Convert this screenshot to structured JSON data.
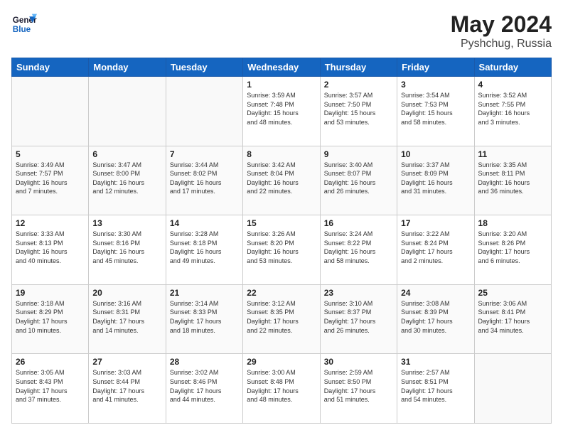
{
  "logo": {
    "line1": "General",
    "line2": "Blue"
  },
  "title": {
    "month_year": "May 2024",
    "location": "Pyshchug, Russia"
  },
  "days_of_week": [
    "Sunday",
    "Monday",
    "Tuesday",
    "Wednesday",
    "Thursday",
    "Friday",
    "Saturday"
  ],
  "weeks": [
    [
      {
        "day": "",
        "info": ""
      },
      {
        "day": "",
        "info": ""
      },
      {
        "day": "",
        "info": ""
      },
      {
        "day": "1",
        "info": "Sunrise: 3:59 AM\nSunset: 7:48 PM\nDaylight: 15 hours\nand 48 minutes."
      },
      {
        "day": "2",
        "info": "Sunrise: 3:57 AM\nSunset: 7:50 PM\nDaylight: 15 hours\nand 53 minutes."
      },
      {
        "day": "3",
        "info": "Sunrise: 3:54 AM\nSunset: 7:53 PM\nDaylight: 15 hours\nand 58 minutes."
      },
      {
        "day": "4",
        "info": "Sunrise: 3:52 AM\nSunset: 7:55 PM\nDaylight: 16 hours\nand 3 minutes."
      }
    ],
    [
      {
        "day": "5",
        "info": "Sunrise: 3:49 AM\nSunset: 7:57 PM\nDaylight: 16 hours\nand 7 minutes."
      },
      {
        "day": "6",
        "info": "Sunrise: 3:47 AM\nSunset: 8:00 PM\nDaylight: 16 hours\nand 12 minutes."
      },
      {
        "day": "7",
        "info": "Sunrise: 3:44 AM\nSunset: 8:02 PM\nDaylight: 16 hours\nand 17 minutes."
      },
      {
        "day": "8",
        "info": "Sunrise: 3:42 AM\nSunset: 8:04 PM\nDaylight: 16 hours\nand 22 minutes."
      },
      {
        "day": "9",
        "info": "Sunrise: 3:40 AM\nSunset: 8:07 PM\nDaylight: 16 hours\nand 26 minutes."
      },
      {
        "day": "10",
        "info": "Sunrise: 3:37 AM\nSunset: 8:09 PM\nDaylight: 16 hours\nand 31 minutes."
      },
      {
        "day": "11",
        "info": "Sunrise: 3:35 AM\nSunset: 8:11 PM\nDaylight: 16 hours\nand 36 minutes."
      }
    ],
    [
      {
        "day": "12",
        "info": "Sunrise: 3:33 AM\nSunset: 8:13 PM\nDaylight: 16 hours\nand 40 minutes."
      },
      {
        "day": "13",
        "info": "Sunrise: 3:30 AM\nSunset: 8:16 PM\nDaylight: 16 hours\nand 45 minutes."
      },
      {
        "day": "14",
        "info": "Sunrise: 3:28 AM\nSunset: 8:18 PM\nDaylight: 16 hours\nand 49 minutes."
      },
      {
        "day": "15",
        "info": "Sunrise: 3:26 AM\nSunset: 8:20 PM\nDaylight: 16 hours\nand 53 minutes."
      },
      {
        "day": "16",
        "info": "Sunrise: 3:24 AM\nSunset: 8:22 PM\nDaylight: 16 hours\nand 58 minutes."
      },
      {
        "day": "17",
        "info": "Sunrise: 3:22 AM\nSunset: 8:24 PM\nDaylight: 17 hours\nand 2 minutes."
      },
      {
        "day": "18",
        "info": "Sunrise: 3:20 AM\nSunset: 8:26 PM\nDaylight: 17 hours\nand 6 minutes."
      }
    ],
    [
      {
        "day": "19",
        "info": "Sunrise: 3:18 AM\nSunset: 8:29 PM\nDaylight: 17 hours\nand 10 minutes."
      },
      {
        "day": "20",
        "info": "Sunrise: 3:16 AM\nSunset: 8:31 PM\nDaylight: 17 hours\nand 14 minutes."
      },
      {
        "day": "21",
        "info": "Sunrise: 3:14 AM\nSunset: 8:33 PM\nDaylight: 17 hours\nand 18 minutes."
      },
      {
        "day": "22",
        "info": "Sunrise: 3:12 AM\nSunset: 8:35 PM\nDaylight: 17 hours\nand 22 minutes."
      },
      {
        "day": "23",
        "info": "Sunrise: 3:10 AM\nSunset: 8:37 PM\nDaylight: 17 hours\nand 26 minutes."
      },
      {
        "day": "24",
        "info": "Sunrise: 3:08 AM\nSunset: 8:39 PM\nDaylight: 17 hours\nand 30 minutes."
      },
      {
        "day": "25",
        "info": "Sunrise: 3:06 AM\nSunset: 8:41 PM\nDaylight: 17 hours\nand 34 minutes."
      }
    ],
    [
      {
        "day": "26",
        "info": "Sunrise: 3:05 AM\nSunset: 8:43 PM\nDaylight: 17 hours\nand 37 minutes."
      },
      {
        "day": "27",
        "info": "Sunrise: 3:03 AM\nSunset: 8:44 PM\nDaylight: 17 hours\nand 41 minutes."
      },
      {
        "day": "28",
        "info": "Sunrise: 3:02 AM\nSunset: 8:46 PM\nDaylight: 17 hours\nand 44 minutes."
      },
      {
        "day": "29",
        "info": "Sunrise: 3:00 AM\nSunset: 8:48 PM\nDaylight: 17 hours\nand 48 minutes."
      },
      {
        "day": "30",
        "info": "Sunrise: 2:59 AM\nSunset: 8:50 PM\nDaylight: 17 hours\nand 51 minutes."
      },
      {
        "day": "31",
        "info": "Sunrise: 2:57 AM\nSunset: 8:51 PM\nDaylight: 17 hours\nand 54 minutes."
      },
      {
        "day": "",
        "info": ""
      }
    ]
  ]
}
